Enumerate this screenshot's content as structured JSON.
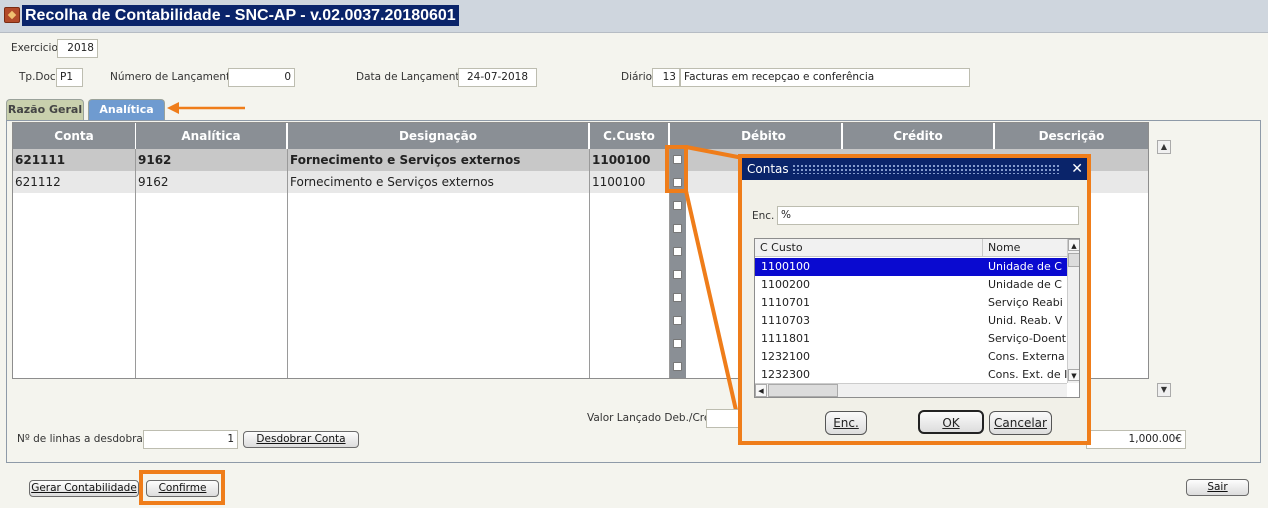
{
  "window": {
    "title": "Recolha de Contabilidade - SNC-AP - v.02.0037.20180601"
  },
  "header": {
    "exercicio_label": "Exercicio",
    "exercicio_value": "2018",
    "tpdoc_label": "Tp.Doc.",
    "tpdoc_value": "P1",
    "numero_label": "Número de Lançamento:",
    "numero_value": "0",
    "data_label": "Data de Lançamento:",
    "data_value": "24-07-2018",
    "diario_label": "Diário:",
    "diario_code": "13",
    "diario_desc": "Facturas em recepçao e conferência"
  },
  "tabs": [
    {
      "label": "Razão Geral",
      "active": false
    },
    {
      "label": "Analítica",
      "active": true
    }
  ],
  "grid": {
    "columns": [
      "Conta",
      "Analítica",
      "Designação",
      "C.Custo",
      "Débito",
      "Crédito",
      "Descrição"
    ],
    "rows": [
      {
        "conta": "621111",
        "analitica": "9162",
        "designacao": "Fornecimento e Serviços externos",
        "ccusto": "1100100",
        "selected": true
      },
      {
        "conta": "621112",
        "analitica": "9162",
        "designacao": "Fornecimento e Serviços externos",
        "ccusto": "1100100",
        "selected": false
      }
    ]
  },
  "footer": {
    "valor_label": "Valor Lançado Deb./Cre.",
    "total_value": "1,000.00€",
    "linhas_label": "Nº de linhas a desdobrar:",
    "linhas_value": "1",
    "desdobrar_button": "Desdobrar Conta",
    "gerar_button": "Gerar Contabilidade",
    "confirme_button": "Confirme",
    "sair_button": "Sair"
  },
  "dialog": {
    "title": "Contas",
    "enc_label": "Enc.",
    "enc_value": "%",
    "columns": [
      "C Custo",
      "Nome"
    ],
    "rows": [
      {
        "ccusto": "1100100",
        "nome": "Unidade de C",
        "selected": true
      },
      {
        "ccusto": "1100200",
        "nome": "Unidade de C"
      },
      {
        "ccusto": "1110701",
        "nome": "Serviço Reabi"
      },
      {
        "ccusto": "1110703",
        "nome": "Unid. Reab. V"
      },
      {
        "ccusto": "1111801",
        "nome": "Serviço-Doent"
      },
      {
        "ccusto": "1232100",
        "nome": "Cons. Externa"
      },
      {
        "ccusto": "1232300",
        "nome": "Cons. Ext. de I"
      }
    ],
    "enc_button": "Enc.",
    "ok_button": "OK",
    "cancel_button": "Cancelar"
  },
  "colors": {
    "highlight": "#ef7d1a",
    "title_bg": "#0a246a",
    "header_gray": "#8a8f95"
  }
}
